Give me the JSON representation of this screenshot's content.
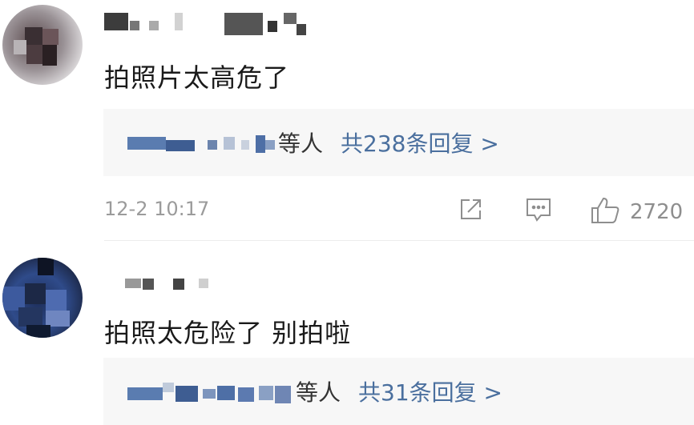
{
  "comments": [
    {
      "text": "拍照片太高危了",
      "reply_suffix": "等人",
      "reply_link": "共238条回复 >",
      "timestamp": "12-2 10:17",
      "like_count": "2720"
    },
    {
      "text": "拍照太危险了 别拍啦",
      "reply_suffix": "等人",
      "reply_link": "共31条回复 >"
    }
  ],
  "icons": {
    "share": "share-edit-icon",
    "reply": "comment-icon",
    "like": "thumbs-up-icon"
  },
  "colors": {
    "link": "#4a6f9e",
    "muted": "#9b9b9b",
    "reply_background": "#f7f7f7"
  }
}
